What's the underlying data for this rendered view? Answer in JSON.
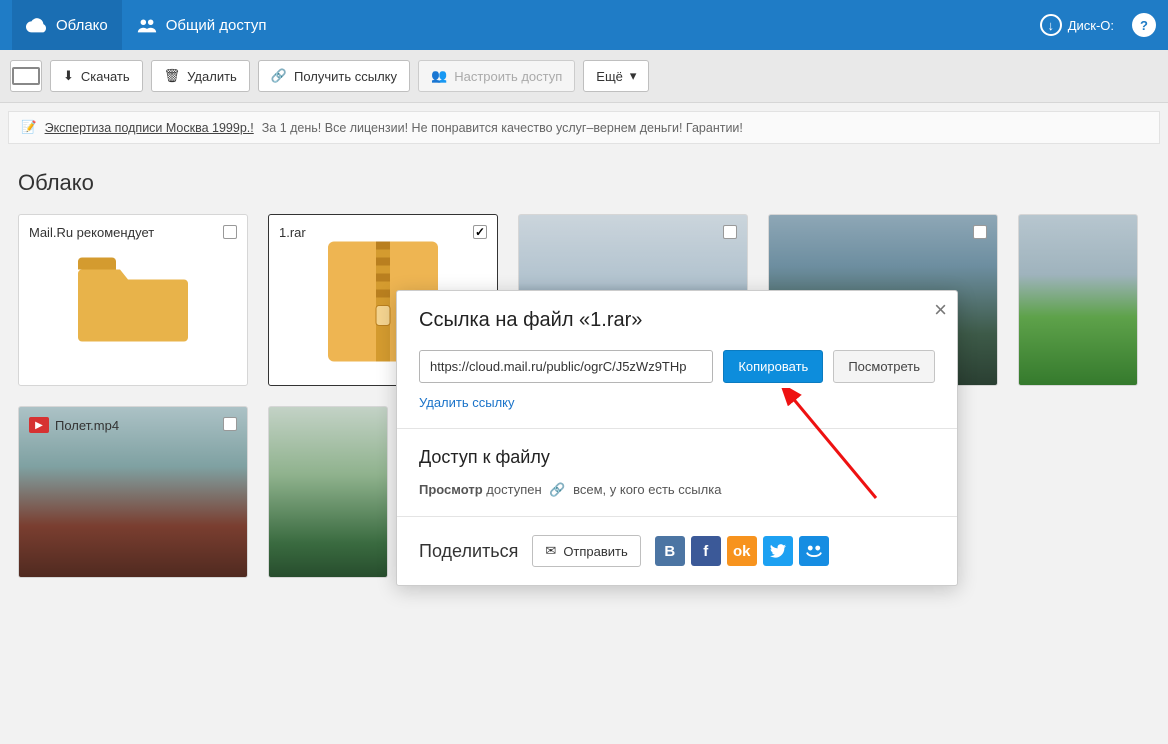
{
  "topbar": {
    "cloud_label": "Облако",
    "shared_label": "Общий доступ",
    "disko_label": "Диск-О:"
  },
  "toolbar": {
    "download": "Скачать",
    "delete": "Удалить",
    "get_link": "Получить ссылку",
    "configure_access": "Настроить доступ",
    "more": "Ещё"
  },
  "ad": {
    "link_text": "Экспертиза подписи Москва 1999р.!",
    "text": "За 1 день! Все лицензии! Не понравится качество услуг–вернем деньги! Гарантии!"
  },
  "section_title": "Облако",
  "items": [
    {
      "name": "Mail.Ru рекомендует",
      "kind": "folder",
      "selected": false
    },
    {
      "name": "1.rar",
      "kind": "archive",
      "selected": true
    },
    {
      "name": "",
      "kind": "image",
      "thumb": "thumb1",
      "selected": false
    },
    {
      "name": "",
      "kind": "image",
      "thumb": "thumb2",
      "selected": false
    },
    {
      "name": "",
      "kind": "image",
      "thumb": "thumb3",
      "selected": false
    },
    {
      "name": "Полет.mp4",
      "kind": "video",
      "thumb": "thumb4",
      "selected": false
    },
    {
      "name": "",
      "kind": "image",
      "thumb": "thumb5",
      "selected": false
    }
  ],
  "modal": {
    "title": "Ссылка на файл «1.rar»",
    "link_value": "https://cloud.mail.ru/public/ogrC/J5zWz9THp",
    "copy_label": "Копировать",
    "view_label": "Посмотреть",
    "delete_link_label": "Удалить ссылку",
    "access_title": "Доступ к файлу",
    "access_view_label": "Просмотр",
    "access_available": "доступен",
    "access_for": "всем, у кого есть ссылка",
    "share_title": "Поделиться",
    "send_label": "Отправить"
  },
  "colors": {
    "primary": "#1f7cc6",
    "accent": "#0d8ddc"
  }
}
